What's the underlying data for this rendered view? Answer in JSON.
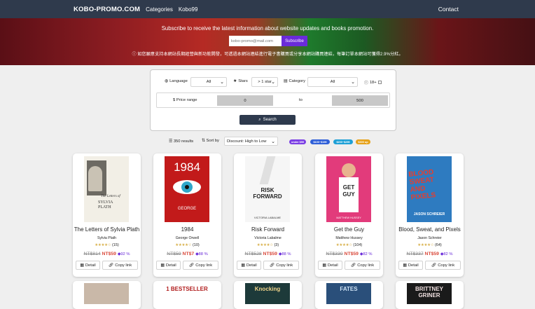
{
  "nav": {
    "brand": "KOBO-PROMO.COM",
    "categories": "Categories",
    "kobo99": "Kobo99",
    "contact": "Contact"
  },
  "hero": {
    "subscribe_text": "Subscribe to receive the latest information about website updates and books promotion.",
    "email_placeholder": "kobo-promo@mail.com",
    "subscribe_button": "Subscribe",
    "notice": "如您願意支持本網站長期經營與新功能開發，可透過本網站連結進行電子書購買或分享本網站購買連結，每筆訂單本網站可獲得2.9%分紅。"
  },
  "filters": {
    "language_label": "Language",
    "language_value": "All",
    "stars_label": "Stars",
    "stars_value": "> 1 star",
    "category_label": "Category",
    "category_value": "All",
    "adult_label": "18+",
    "price_label": "Price range",
    "price_min": "0",
    "price_to": "to",
    "price_max": "500",
    "search_button": "Search"
  },
  "results": {
    "count_text": "350 results",
    "sort_label": "Sort by",
    "sort_value": "Discount: High to Low",
    "chips": [
      {
        "label": "under $59",
        "color": "#7b3fe4"
      },
      {
        "label": "$100~$199",
        "color": "#2f5fd8"
      },
      {
        "label": "$200~$299",
        "color": "#1ea0d6"
      },
      {
        "label": "$300 up",
        "color": "#e6a21a"
      }
    ]
  },
  "books": [
    {
      "title": "The Letters of Sylvia Plath",
      "author": "Sylvia Plath",
      "reviews": "(15)",
      "old_price": "NT$814",
      "new_price": "NT$59",
      "discount": "92 %",
      "detail": "Detail",
      "copy": "Copy link",
      "cover_text_1": "The Letters of",
      "cover_text_2": "SYLVIA PLATH"
    },
    {
      "title": "1984",
      "author": "George Orwell",
      "reviews": "(10)",
      "old_price": "NT$59",
      "new_price": "NT$7",
      "discount": "88 %",
      "detail": "Detail",
      "copy": "Copy link",
      "cover_text_1": "1984",
      "cover_text_2": "GEORGE"
    },
    {
      "title": "Risk Forward",
      "author": "Victoria Labalme",
      "reviews": "(3)",
      "old_price": "NT$528",
      "new_price": "NT$59",
      "discount": "88 %",
      "detail": "Detail",
      "copy": "Copy link",
      "cover_text_1": "RISK FORWARD",
      "cover_text_2": "VICTORIA LABALME"
    },
    {
      "title": "Get the Guy",
      "author": "Matthew Hussey",
      "reviews": "(104)",
      "old_price": "NT$330",
      "new_price": "NT$59",
      "discount": "82 %",
      "detail": "Detail",
      "copy": "Copy link",
      "cover_text_1": "GET GUY",
      "cover_text_2": "MATTHEW HUSSEY"
    },
    {
      "title": "Blood, Sweat, and Pixels",
      "author": "Jason Schreier",
      "reviews": "(64)",
      "old_price": "NT$337",
      "new_price": "NT$59",
      "discount": "82 %",
      "detail": "Detail",
      "copy": "Copy link",
      "cover_text_1": "BLOOD SWEAT AND PIXELS",
      "cover_text_2": "JASON SCHREIER"
    }
  ],
  "row2": [
    {
      "cover_text": ""
    },
    {
      "cover_text": "1 BESTSELLER"
    },
    {
      "cover_text": "Knocking"
    },
    {
      "cover_text": "FATES"
    },
    {
      "cover_text": "BRITTNEY GRINER"
    }
  ],
  "colors": {
    "nav": "#2f3a4c",
    "accent": "#6a2bd9",
    "price_new": "#d9483a",
    "star": "#d8b04a"
  }
}
